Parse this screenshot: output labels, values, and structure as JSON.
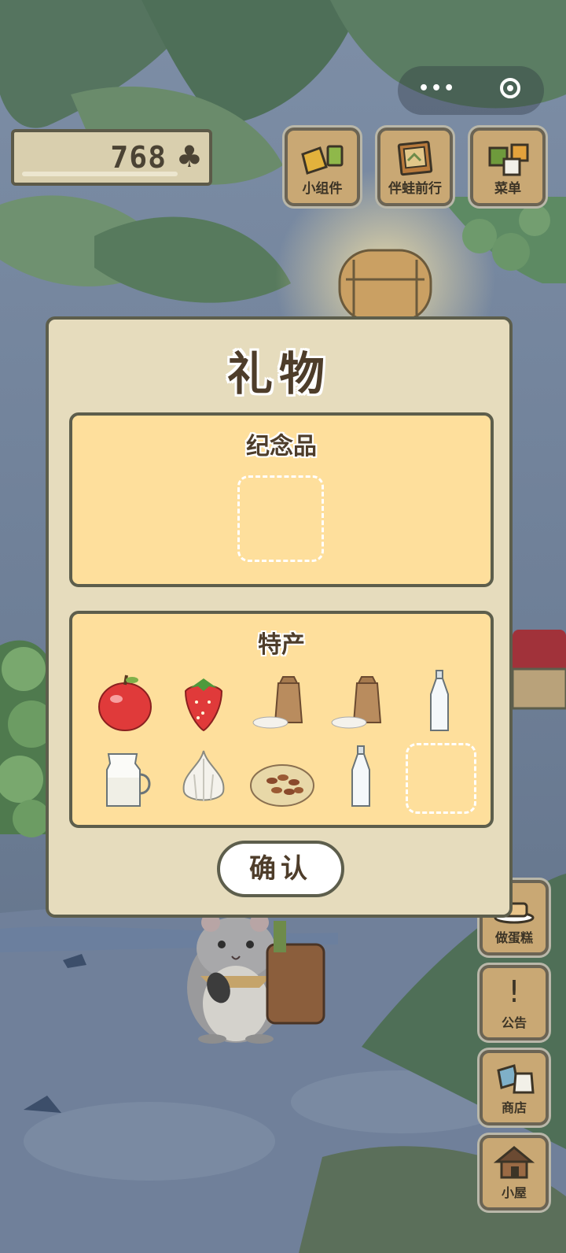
{
  "clover": {
    "count": "768",
    "icon": "clover-icon"
  },
  "capsule": {
    "more_icon": "more-dots-icon",
    "close_icon": "target-close-icon"
  },
  "top_buttons": [
    {
      "label": "小组件",
      "icon": "widget-icon"
    },
    {
      "label": "伴蛙前行",
      "icon": "album-icon"
    },
    {
      "label": "菜单",
      "icon": "menu-icon"
    }
  ],
  "side_buttons": [
    {
      "label": "做蛋糕",
      "icon": "cake-icon"
    },
    {
      "label": "公告",
      "icon": "exclamation-icon"
    },
    {
      "label": "商店",
      "icon": "shop-bags-icon"
    },
    {
      "label": "小屋",
      "icon": "house-icon"
    }
  ],
  "dialog": {
    "title": "礼物",
    "souvenir_title": "纪念品",
    "specialty_title": "特产",
    "confirm_label": "确认",
    "specialty_items": [
      "apple-icon",
      "strawberry-icon",
      "rice-sack-icon",
      "rice-sack-icon",
      "glass-bottle-icon",
      "milk-jug-icon",
      "garlic-icon",
      "nuts-plate-icon",
      "glass-bottle-icon"
    ]
  },
  "colors": {
    "dialog_bg": "#e6dcbd",
    "panel_bg": "#fedf9c",
    "border": "#5d5e4c",
    "button_wood": "#c9a874"
  }
}
